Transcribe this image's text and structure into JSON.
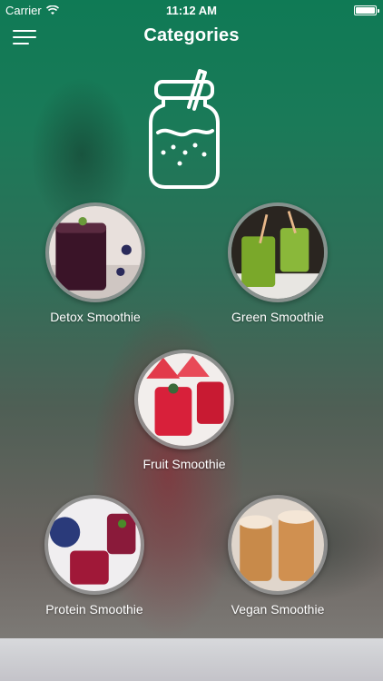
{
  "status_bar": {
    "carrier": "Carrier",
    "time": "11:12 AM",
    "wifi_icon": "wifi-icon",
    "battery_icon": "battery-icon",
    "battery_level": 1.0
  },
  "nav": {
    "title": "Categories",
    "menu_icon": "hamburger-menu-icon"
  },
  "header_icon": "smoothie-jar-icon",
  "categories": [
    {
      "label": "Detox Smoothie"
    },
    {
      "label": "Green Smoothie"
    },
    {
      "label": "Fruit Smoothie"
    },
    {
      "label": "Protein Smoothie"
    },
    {
      "label": "Vegan Smoothie"
    }
  ]
}
